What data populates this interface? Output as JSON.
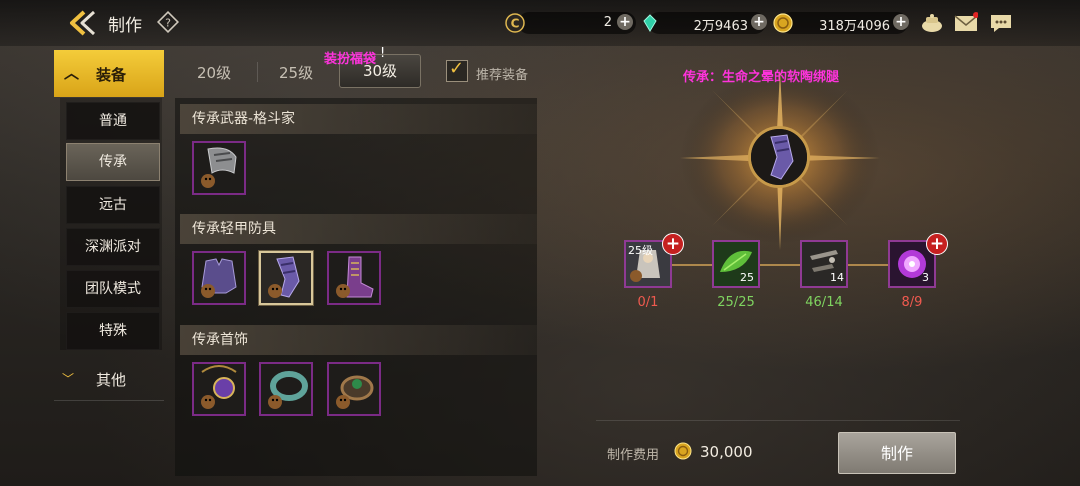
{
  "header": {
    "title": "制作",
    "currency": [
      {
        "value": "2"
      },
      {
        "value": "2万9463"
      },
      {
        "value": "318万4096"
      }
    ]
  },
  "sidebar": {
    "main_category": "装备",
    "sub_items": [
      "普通",
      "传承",
      "远古",
      "深渊派对",
      "团队模式",
      "特殊"
    ],
    "active_sub": "传承",
    "other_category": "其他"
  },
  "levels": {
    "tabs": [
      "20级",
      "25级",
      "30级"
    ],
    "active": "30级",
    "recommend_label": "推荐装备",
    "recommend_checked": true
  },
  "annotations": {
    "top_text": "装扮福袋",
    "cursor_text": "!",
    "inherit_title": "传承：生命之晕的软陶绑腿"
  },
  "sections": [
    {
      "title": "传承武器-格斗家"
    },
    {
      "title": "传承轻甲防具"
    },
    {
      "title": "传承首饰"
    }
  ],
  "materials": [
    {
      "badge": "25级",
      "count": "0/1",
      "status": "insufficient",
      "has_plus": true
    },
    {
      "badge": "25",
      "count": "25/25",
      "status": "ok",
      "has_plus": false
    },
    {
      "badge": "14",
      "count": "46/14",
      "status": "ok",
      "has_plus": false
    },
    {
      "badge": "3",
      "count": "8/9",
      "status": "insufficient",
      "has_plus": true
    }
  ],
  "cost": {
    "label": "制作费用",
    "value": "30,000"
  },
  "make_button": "制作",
  "colors": {
    "accent_gold": "#f0c040",
    "rarity_purple": "#7b2b86",
    "annotation_magenta": "#ff33dd",
    "insufficient_red": "#ef5a4f",
    "sufficient_green": "#7fd460"
  }
}
